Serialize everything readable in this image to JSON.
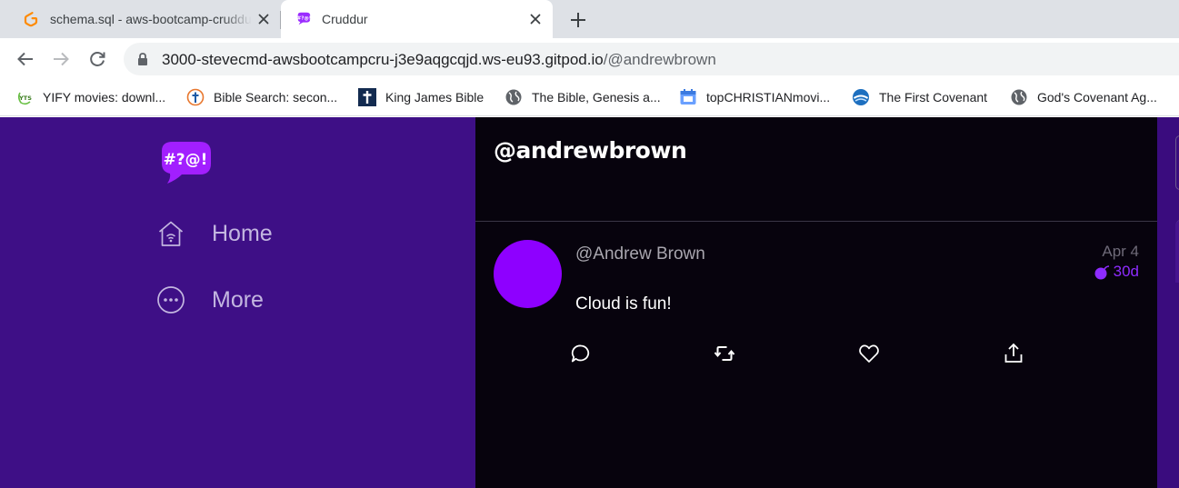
{
  "browser": {
    "tabs": [
      {
        "title": "schema.sql - aws-bootcamp-cruddur",
        "icon": "gitpod-icon",
        "active": false
      },
      {
        "title": "Cruddur",
        "icon": "cruddur-icon",
        "active": true
      }
    ],
    "address": {
      "host": "3000-stevecmd-awsbootcampcru-j3e9aqgcqjd.ws-eu93.gitpod.io",
      "path": "/@andrewbrown"
    },
    "bookmarks": [
      {
        "label": "YIFY movies: downl...",
        "icon": "yts-icon"
      },
      {
        "label": "Bible Search: secon...",
        "icon": "bible-search-icon"
      },
      {
        "label": "King James Bible",
        "icon": "cross-icon"
      },
      {
        "label": "The Bible, Genesis a...",
        "icon": "globe-icon"
      },
      {
        "label": "topCHRISTIANmovi...",
        "icon": "calendar-icon"
      },
      {
        "label": "The First Covenant",
        "icon": "covenant-icon"
      },
      {
        "label": "God's Covenant Ag...",
        "icon": "globe-icon"
      }
    ]
  },
  "app": {
    "logo_text": "#?@!",
    "nav": [
      {
        "label": "Home",
        "icon": "home-icon"
      },
      {
        "label": "More",
        "icon": "more-icon"
      }
    ],
    "feed_title": "@andrewbrown",
    "post": {
      "handle": "@Andrew Brown",
      "date": "Apr 4",
      "expiry": "30d",
      "message": "Cloud is fun!",
      "actions": [
        "reply",
        "repost",
        "like",
        "share"
      ]
    }
  },
  "colors": {
    "sidebar": "#3e0f86",
    "feed": "#07030d",
    "accent": "#8e00ff"
  }
}
